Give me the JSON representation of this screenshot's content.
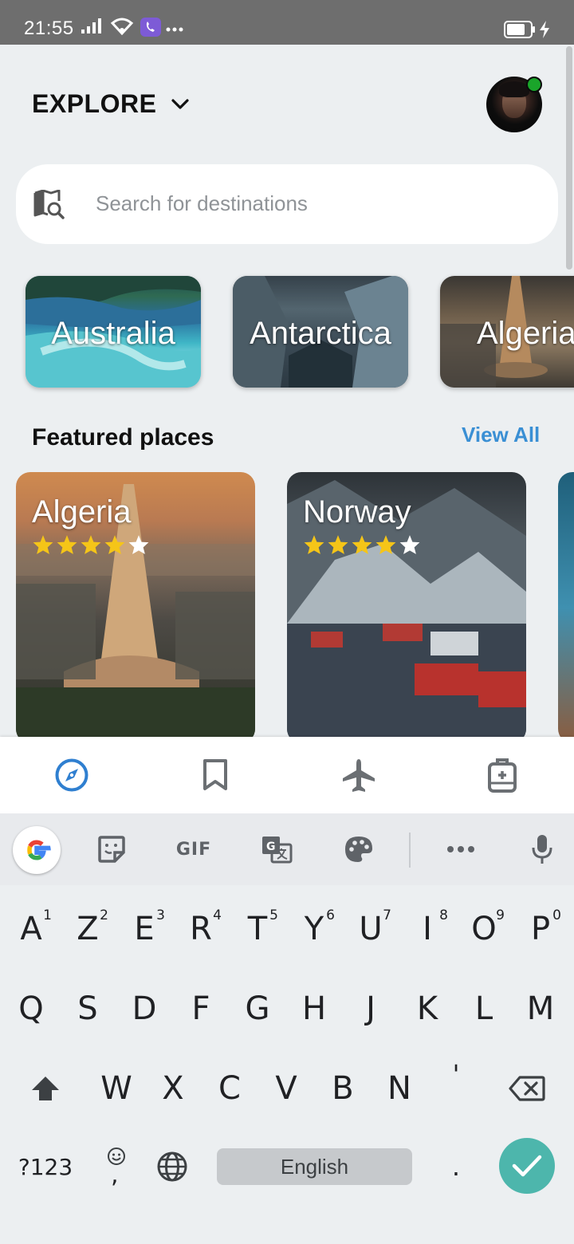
{
  "status_bar": {
    "time": "21:55",
    "icons": [
      "signal-icon",
      "wifi-icon",
      "viber-icon",
      "more-notifications-icon",
      "battery-icon",
      "charging-icon"
    ]
  },
  "header": {
    "title": "EXPLORE",
    "avatar_status_color": "#1aa52a"
  },
  "search": {
    "placeholder": "Search for destinations",
    "value": ""
  },
  "countries": [
    {
      "label": "Australia"
    },
    {
      "label": "Antarctica"
    },
    {
      "label": "Algeria"
    }
  ],
  "featured": {
    "title": "Featured places",
    "view_all": "View All",
    "accent_color": "#3a8fd4",
    "places": [
      {
        "name": "Algeria",
        "rating": 4,
        "max_rating": 5
      },
      {
        "name": "Norway",
        "rating": 4,
        "max_rating": 5
      }
    ]
  },
  "bottom_nav": {
    "items": [
      "compass-icon",
      "bookmark-icon",
      "airplane-icon",
      "luggage-icon"
    ],
    "active_index": 0,
    "active_color": "#2f7fd0"
  },
  "keyboard": {
    "toolbar": {
      "gif_label": "GIF"
    },
    "row1": [
      {
        "key": "A",
        "hint": "1"
      },
      {
        "key": "Z",
        "hint": "2"
      },
      {
        "key": "E",
        "hint": "3"
      },
      {
        "key": "R",
        "hint": "4"
      },
      {
        "key": "T",
        "hint": "5"
      },
      {
        "key": "Y",
        "hint": "6"
      },
      {
        "key": "U",
        "hint": "7"
      },
      {
        "key": "I",
        "hint": "8"
      },
      {
        "key": "O",
        "hint": "9"
      },
      {
        "key": "P",
        "hint": "0"
      }
    ],
    "row2": [
      "Q",
      "S",
      "D",
      "F",
      "G",
      "H",
      "J",
      "K",
      "L",
      "M"
    ],
    "row3": [
      "W",
      "X",
      "C",
      "V",
      "B",
      "N",
      "'"
    ],
    "symbols_label": "?123",
    "comma_label": ",",
    "space_label": "English",
    "period_label": ".",
    "enter_color": "#4db6ac"
  }
}
